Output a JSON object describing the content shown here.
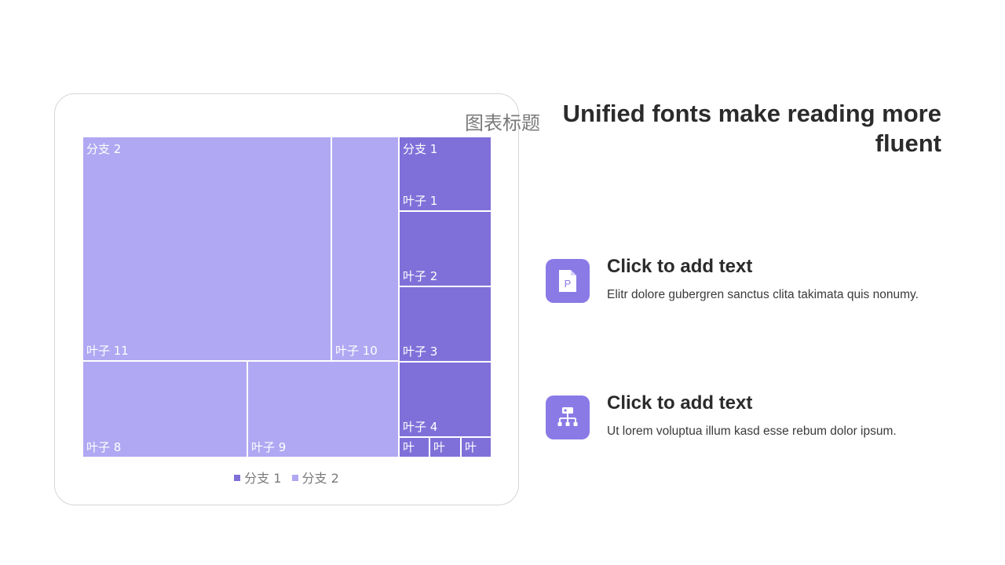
{
  "chart_data": {
    "type": "treemap",
    "title": "图表标题",
    "legend": {
      "position": "bottom",
      "entries": [
        "分支 1",
        "分支 2"
      ]
    },
    "colors": {
      "分支 1": "#7f70d9",
      "分支 2": "#b0a8f2"
    },
    "series": [
      {
        "name": "分支 1",
        "leaves": [
          {
            "label": "叶子 1",
            "value": 10
          },
          {
            "label": "叶子 2",
            "value": 10
          },
          {
            "label": "叶子 3",
            "value": 10
          },
          {
            "label": "叶子 4",
            "value": 10
          },
          {
            "label": "叶",
            "value": 2.67
          },
          {
            "label": "叶",
            "value": 2.67
          },
          {
            "label": "叶",
            "value": 2.67
          }
        ]
      },
      {
        "name": "分支 2",
        "leaves": [
          {
            "label": "叶子 11",
            "value": 100
          },
          {
            "label": "叶子 10",
            "value": 27
          },
          {
            "label": "叶子 8",
            "value": 28
          },
          {
            "label": "叶子 9",
            "value": 26
          }
        ]
      }
    ]
  },
  "headline": "Unified fonts make reading more fluent",
  "features": [
    {
      "icon": "document-p-icon",
      "title": "Click to add text",
      "text": "Elitr dolore gubergren sanctus clita takimata quis nonumy."
    },
    {
      "icon": "hierarchy-icon",
      "title": "Click to add text",
      "text": "Ut lorem voluptua illum kasd esse rebum dolor ipsum."
    }
  ]
}
